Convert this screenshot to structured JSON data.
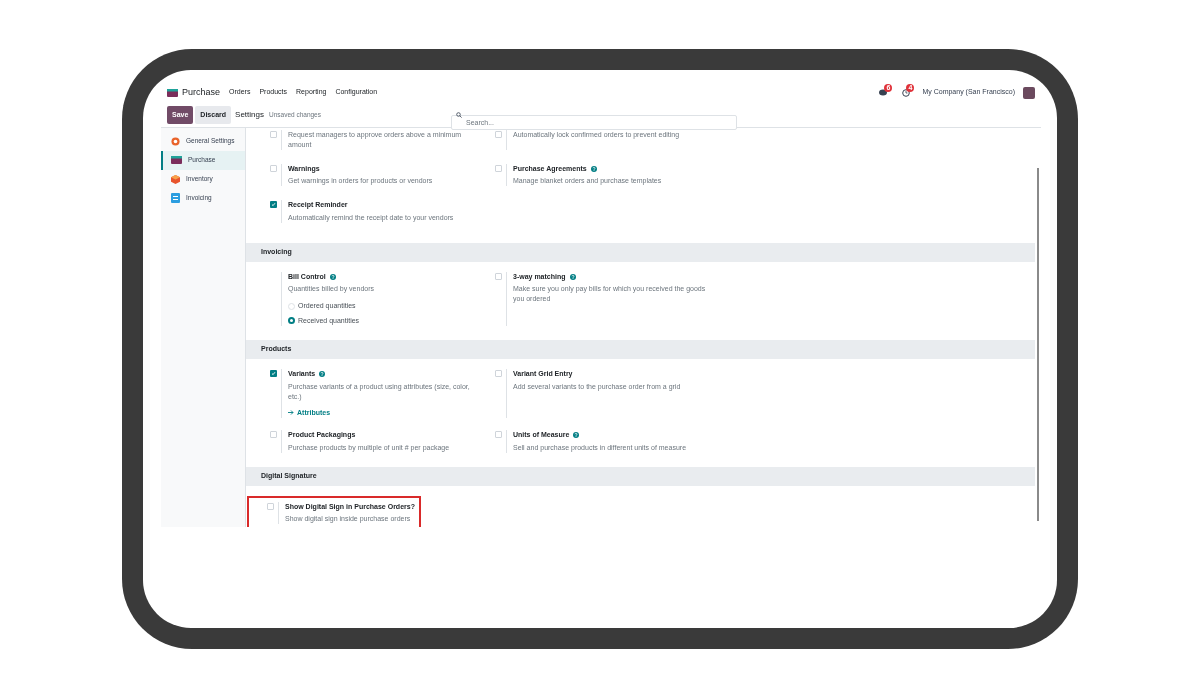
{
  "navbar": {
    "app_name": "Purchase",
    "menu": [
      "Orders",
      "Products",
      "Reporting",
      "Configuration"
    ],
    "messages_badge": "6",
    "activities_badge": "4",
    "company": "My Company (San Francisco)"
  },
  "control_panel": {
    "save": "Save",
    "discard": "Discard",
    "breadcrumb": "Settings",
    "status": "Unsaved changes",
    "search": {
      "placeholder": "Search..."
    }
  },
  "sidebar": {
    "items": [
      {
        "label": "General Settings",
        "kind": "general",
        "selected": false
      },
      {
        "label": "Purchase",
        "kind": "purchase",
        "selected": true
      },
      {
        "label": "Inventory",
        "kind": "inventory",
        "selected": false
      },
      {
        "label": "Invoicing",
        "kind": "invoicing",
        "selected": false
      }
    ]
  },
  "sections": [
    {
      "settings": [
        {
          "kind": "checkbox",
          "checked": false,
          "description": "Request managers to approve orders above a minimum amount"
        },
        {
          "kind": "checkbox",
          "checked": false,
          "description": "Automatically lock confirmed orders to prevent editing"
        },
        {
          "kind": "checkbox",
          "checked": false,
          "title": "Warnings",
          "help": false,
          "description": "Get warnings in orders for products or vendors"
        },
        {
          "kind": "checkbox",
          "checked": false,
          "title": "Purchase Agreements",
          "help": true,
          "description": "Manage blanket orders and purchase templates"
        },
        {
          "kind": "checkbox",
          "checked": true,
          "title": "Receipt Reminder",
          "help": false,
          "description": "Automatically remind the receipt date to your vendors"
        }
      ]
    },
    {
      "title": "Invoicing",
      "settings": [
        {
          "kind": "radio",
          "title": "Bill Control",
          "help": true,
          "description": "Quantities billed by vendors",
          "options": [
            {
              "label": "Ordered quantities",
              "selected": false
            },
            {
              "label": "Received quantities",
              "selected": true
            }
          ]
        },
        {
          "kind": "checkbox",
          "checked": false,
          "title": "3-way matching",
          "help": true,
          "description": "Make sure you only pay bills for which you received the goods you ordered"
        }
      ]
    },
    {
      "title": "Products",
      "settings": [
        {
          "kind": "checkbox",
          "checked": true,
          "title": "Variants",
          "help": true,
          "description": "Purchase variants of a product using attributes (size, color, etc.)",
          "link": "Attributes"
        },
        {
          "kind": "checkbox",
          "checked": false,
          "title": "Variant Grid Entry",
          "help": false,
          "description": "Add several variants to the purchase order from a grid"
        },
        {
          "kind": "checkbox",
          "checked": false,
          "title": "Product Packagings",
          "help": false,
          "description": "Purchase products by multiple of unit # per package"
        },
        {
          "kind": "checkbox",
          "checked": false,
          "title": "Units of Measure",
          "help": true,
          "description": "Sell and purchase products in different units of measure"
        }
      ]
    },
    {
      "title": "Digital Signature",
      "settings": [
        {
          "kind": "checkbox",
          "checked": false,
          "highlighted": true,
          "title": "Show Digital Sign in Purchase Orders?",
          "help": false,
          "description": "Show digital sign inside purchase orders"
        }
      ]
    }
  ]
}
